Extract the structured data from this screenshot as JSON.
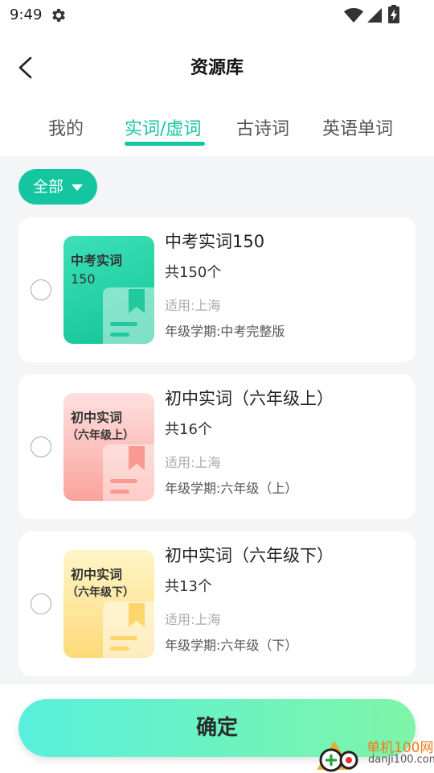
{
  "status_bar": {
    "time": "9:49"
  },
  "header": {
    "title": "资源库"
  },
  "tabs": [
    {
      "label": "我的",
      "active": false
    },
    {
      "label": "实词/虚词",
      "active": true
    },
    {
      "label": "古诗词",
      "active": false
    },
    {
      "label": "英语单词",
      "active": false
    }
  ],
  "filter": {
    "label": "全部"
  },
  "cards": [
    {
      "cover_title": "中考实词",
      "cover_sub": "150",
      "title": "中考实词150",
      "count": "共150个",
      "region": "适用:上海",
      "term": "年级学期:中考完整版",
      "theme": "green"
    },
    {
      "cover_title": "初中实词",
      "cover_sub": "（六年级上）",
      "title": "初中实词（六年级上）",
      "count": "共16个",
      "region": "适用:上海",
      "term": "年级学期:六年级（上）",
      "theme": "pink"
    },
    {
      "cover_title": "初中实词",
      "cover_sub": "（六年级下）",
      "title": "初中实词（六年级下）",
      "count": "共13个",
      "region": "适用:上海",
      "term": "年级学期:六年级（下）",
      "theme": "yellow"
    }
  ],
  "confirm_button": {
    "label": "确定"
  },
  "watermark": {
    "text_cn": "单机100网",
    "text_url": "danji100.com"
  },
  "colors": {
    "accent": "#13c6a0",
    "confirm_gradient_start": "#58f0dc",
    "confirm_gradient_end": "#7ef5a8",
    "cover_green": "#2dd8ab",
    "cover_pink": "#fbb3ae",
    "cover_yellow": "#fde58c"
  }
}
